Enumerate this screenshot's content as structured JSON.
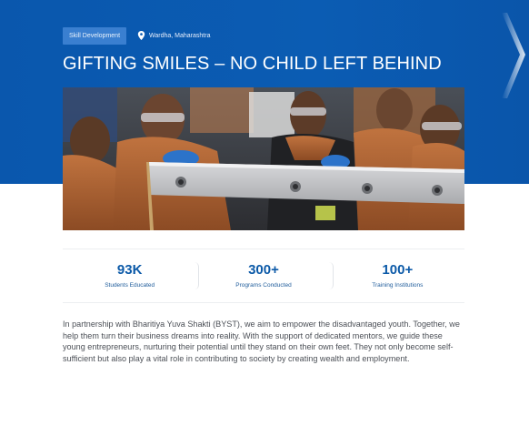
{
  "header": {
    "tag": "Skill Development",
    "location": "Wardha, Maharashtra",
    "title": "GIFTING SMILES – NO CHILD LEFT BEHIND"
  },
  "icons": {
    "location": "location-pin-icon",
    "decoration": "chevron-right-decoration"
  },
  "stats": [
    {
      "value": "93K",
      "label": "Students Educated"
    },
    {
      "value": "300+",
      "label": "Programs Conducted"
    },
    {
      "value": "100+",
      "label": "Training Institutions"
    }
  ],
  "description": "In partnership with Bharitiya Yuva Shakti (BYST), we aim to empower the disadvantaged youth. Together, we help them turn their business dreams into reality. With the support of dedicated mentors, we guide these young entrepreneurs, nurturing their potential until they stand on their own feet. They not only become self-sufficient but also play a vital role in contributing to society by creating wealth and employment.",
  "colors": {
    "brand_blue": "#0b5cb3",
    "tag_blue": "#3a7fd0",
    "stat_blue": "#0c5aa8",
    "body_text": "#4c5057"
  }
}
